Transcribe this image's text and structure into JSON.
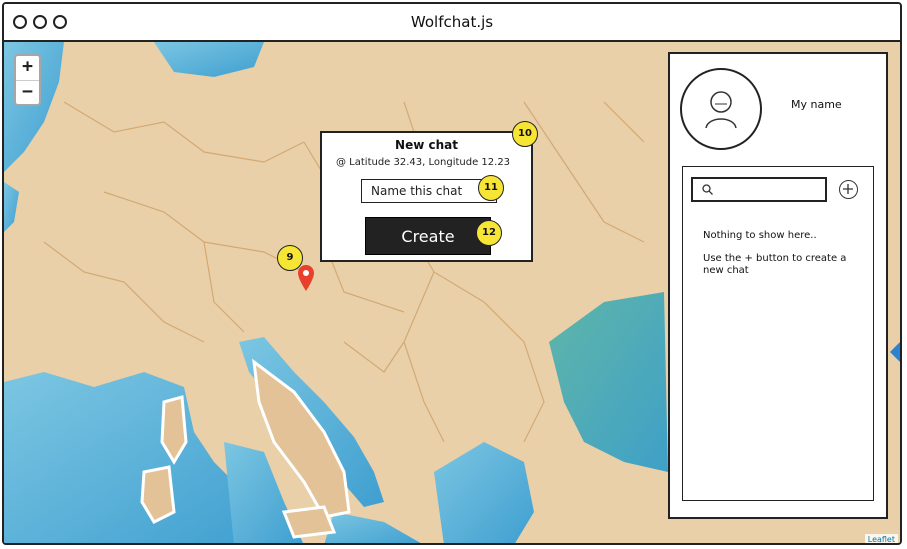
{
  "window": {
    "title": "Wolfchat.js"
  },
  "map": {
    "zoom_in_label": "+",
    "zoom_out_label": "−",
    "attribution": "Leaflet",
    "marker": {
      "badge": "9",
      "icon": "map-pin-icon",
      "color": "#e8402b"
    }
  },
  "popup": {
    "title": "New chat",
    "coords": "@ Latitude 32.43, Longitude 12.23",
    "name_placeholder": "Name this chat",
    "create_label": "Create",
    "badges": {
      "popup": "10",
      "name": "11",
      "create": "12"
    }
  },
  "sidebar": {
    "user_name": "My name",
    "avatar_icon": "user-icon",
    "search_icon": "search-icon",
    "add_icon": "plus-circle-icon",
    "empty_title": "Nothing to show here..",
    "empty_hint": "Use the + button to create a new chat"
  },
  "colors": {
    "badge": "#f7e535",
    "water": "#5fb3d8",
    "land": "#e8c9a0"
  }
}
